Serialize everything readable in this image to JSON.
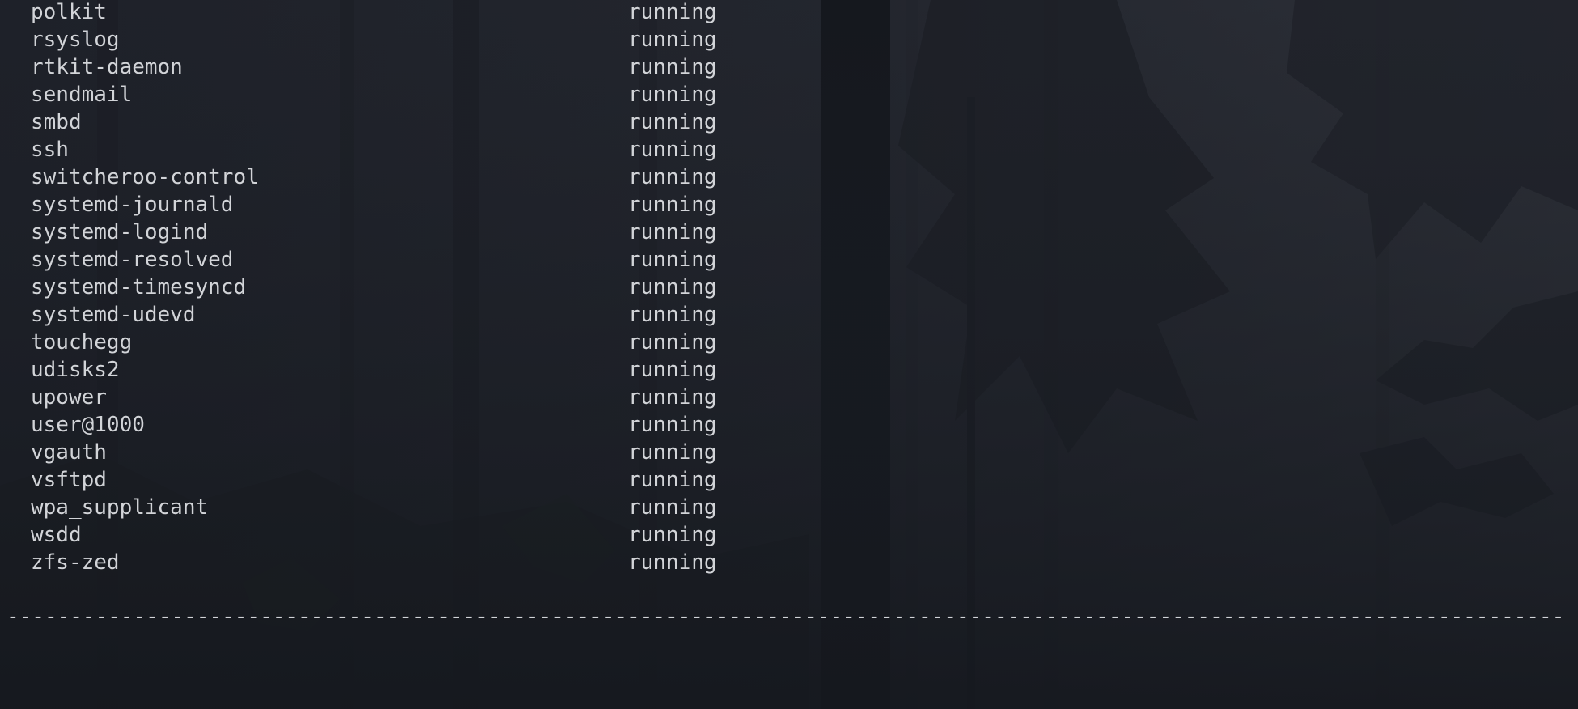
{
  "terminal": {
    "services": [
      {
        "name": "polkit",
        "state": "running"
      },
      {
        "name": "rsyslog",
        "state": "running"
      },
      {
        "name": "rtkit-daemon",
        "state": "running"
      },
      {
        "name": "sendmail",
        "state": "running"
      },
      {
        "name": "smbd",
        "state": "running"
      },
      {
        "name": "ssh",
        "state": "running"
      },
      {
        "name": "switcheroo-control",
        "state": "running"
      },
      {
        "name": "systemd-journald",
        "state": "running"
      },
      {
        "name": "systemd-logind",
        "state": "running"
      },
      {
        "name": "systemd-resolved",
        "state": "running"
      },
      {
        "name": "systemd-timesyncd",
        "state": "running"
      },
      {
        "name": "systemd-udevd",
        "state": "running"
      },
      {
        "name": "touchegg",
        "state": "running"
      },
      {
        "name": "udisks2",
        "state": "running"
      },
      {
        "name": "upower",
        "state": "running"
      },
      {
        "name": "user@1000",
        "state": "running"
      },
      {
        "name": "vgauth",
        "state": "running"
      },
      {
        "name": "vsftpd",
        "state": "running"
      },
      {
        "name": "wpa_supplicant",
        "state": "running"
      },
      {
        "name": "wsdd",
        "state": "running"
      },
      {
        "name": "zfs-zed",
        "state": "running"
      }
    ],
    "separator": "--------------------------------------------------------------------------------------------------------------------------------------------------------------------------------------------"
  },
  "colors": {
    "background": "#1c1f27",
    "text": "#d2d4d8"
  }
}
